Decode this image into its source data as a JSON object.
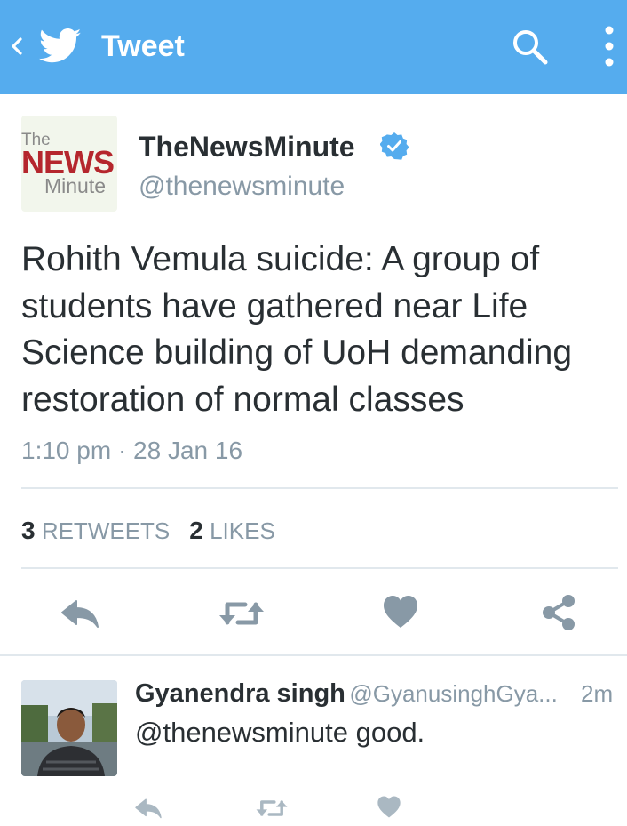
{
  "appbar": {
    "title": "Tweet",
    "color": "#55acee",
    "icons": [
      "chevron-left-icon",
      "twitter-bird-icon",
      "search-icon",
      "more-vertical-icon"
    ]
  },
  "tweet": {
    "logo": {
      "line1": "The",
      "line2": "NEWS",
      "line3": "Minute"
    },
    "author_name": "TheNewsMinute",
    "verified": true,
    "handle": "@thenewsminute",
    "text": "Rohith Vemula suicide: A group of students have gathered near Life Science building of UoH demanding restoration of normal classes",
    "timestamp": "1:10 pm · 28 Jan 16",
    "retweets": "3",
    "retweets_label": "RETWEETS",
    "likes": "2",
    "likes_label": "LIKES"
  },
  "actions": [
    "reply-icon",
    "retweet-icon",
    "like-heart-icon",
    "share-icon"
  ],
  "reply": {
    "name": "Gyanendra singh",
    "handle": "@GyanusinghGya...",
    "time": "2m",
    "text": "@thenewsminute good.",
    "actions": [
      "reply-icon",
      "retweet-icon",
      "like-heart-icon"
    ]
  }
}
